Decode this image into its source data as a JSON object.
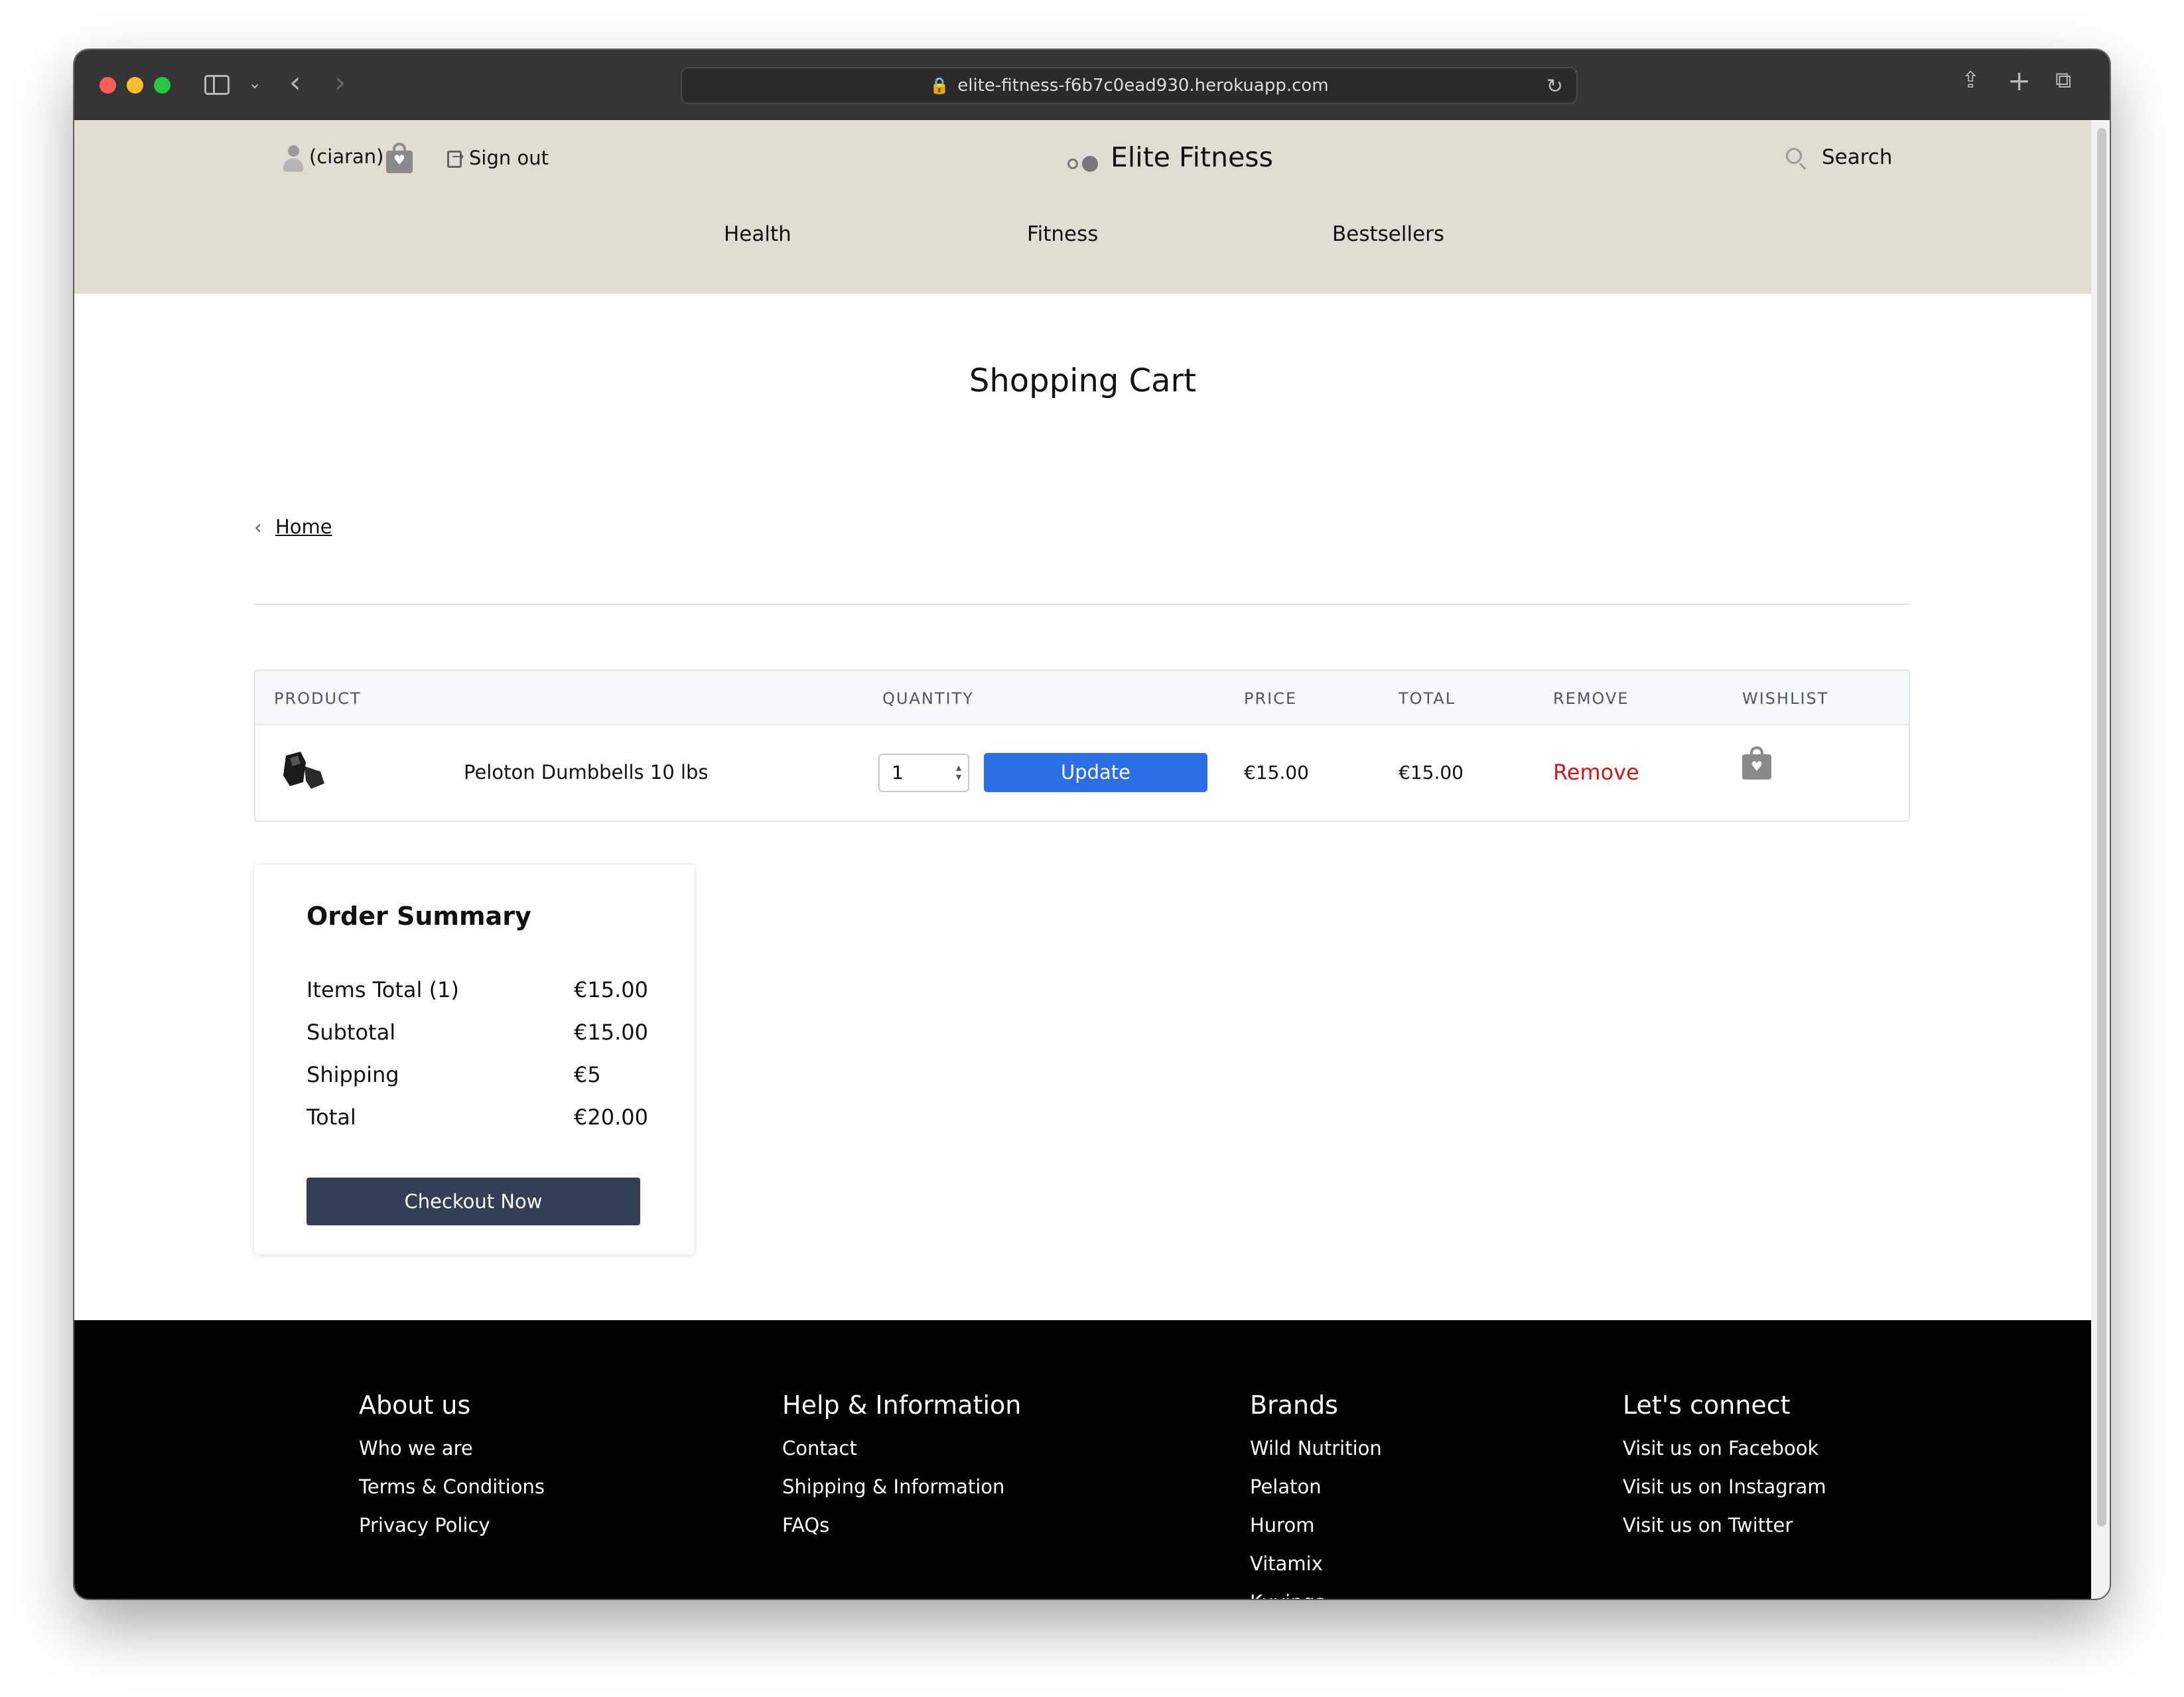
{
  "browser": {
    "url": "elite-fitness-f6b7c0ead930.herokuapp.com"
  },
  "header": {
    "username": "(ciaran)",
    "sign_out": "Sign out",
    "brand": "Elite Fitness",
    "search": "Search",
    "nav": [
      "Health",
      "Fitness",
      "Bestsellers"
    ]
  },
  "page": {
    "title": "Shopping Cart",
    "breadcrumb_home": "Home"
  },
  "cart": {
    "columns": [
      "PRODUCT",
      "QUANTITY",
      "PRICE",
      "TOTAL",
      "REMOVE",
      "WISHLIST"
    ],
    "items": [
      {
        "name": "Peloton Dumbbells 10 lbs",
        "quantity": "1",
        "update_label": "Update",
        "price": "€15.00",
        "total": "€15.00",
        "remove_label": "Remove"
      }
    ]
  },
  "summary": {
    "title": "Order Summary",
    "rows": [
      {
        "label": "Items Total (1)",
        "value": "€15.00"
      },
      {
        "label": "Subtotal",
        "value": "€15.00"
      },
      {
        "label": "Shipping",
        "value": "€5"
      },
      {
        "label": "Total",
        "value": "€20.00"
      }
    ],
    "checkout_label": "Checkout Now"
  },
  "footer": {
    "columns": [
      {
        "title": "About us",
        "links": [
          "Who we are",
          "Terms & Conditions",
          "Privacy Policy"
        ]
      },
      {
        "title": "Help & Information",
        "links": [
          "Contact",
          "Shipping & Information",
          "FAQs"
        ]
      },
      {
        "title": "Brands",
        "links": [
          "Wild Nutrition",
          "Pelaton",
          "Hurom",
          "Vitamix",
          "Kuvings"
        ]
      },
      {
        "title": "Let's connect",
        "links": [
          "Visit us on Facebook",
          "Visit us on Instagram",
          "Visit us on Twitter"
        ]
      }
    ]
  },
  "colors": {
    "header_bg": "#e0ddd2",
    "update_button": "#2b6ee3",
    "remove_link": "#d01818",
    "checkout_button": "#343f55",
    "footer_bg": "#000000"
  }
}
